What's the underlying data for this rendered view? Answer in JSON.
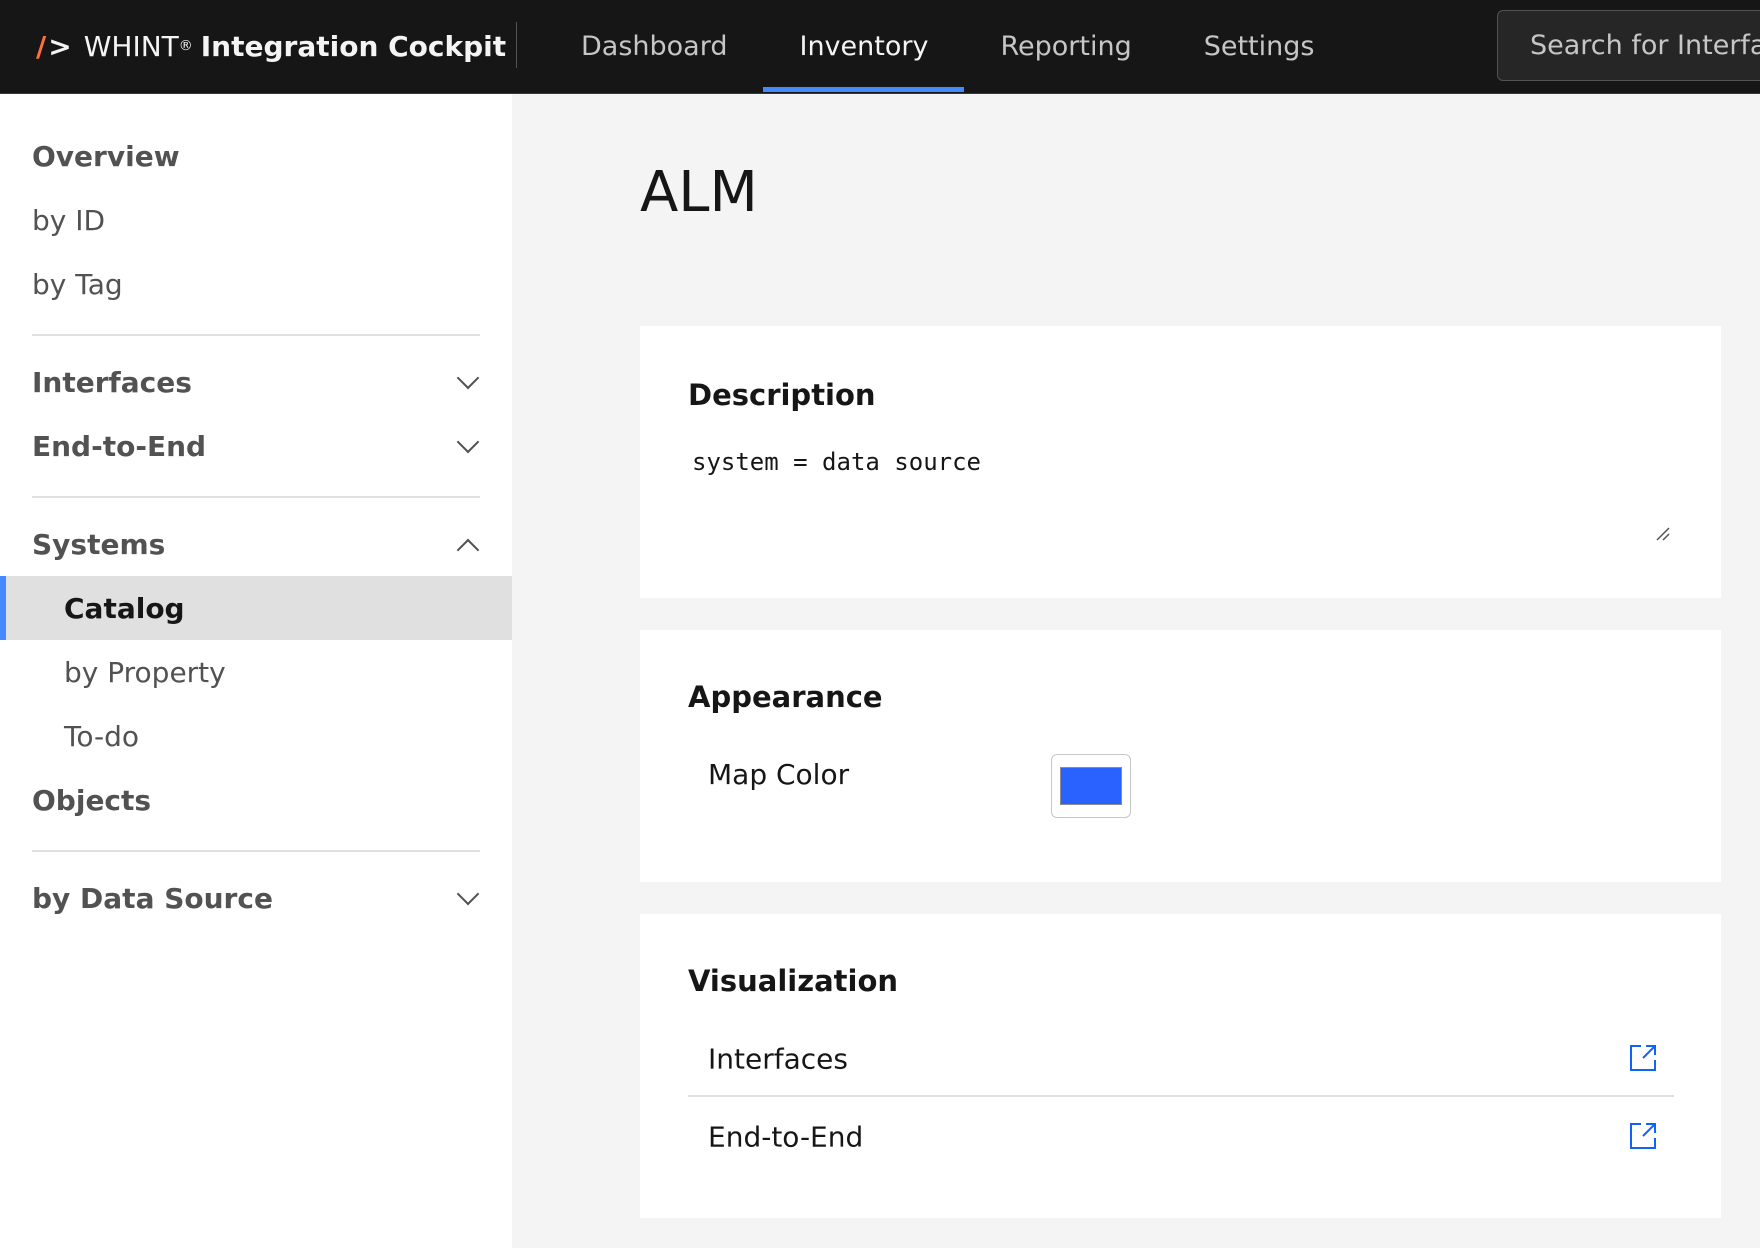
{
  "header": {
    "brand_slash": "/",
    "brand_gt": ">",
    "brand_name": "WHINT",
    "brand_reg": "®",
    "brand_product": "Integration Cockpit",
    "nav": [
      {
        "label": "Dashboard"
      },
      {
        "label": "Inventory"
      },
      {
        "label": "Reporting"
      },
      {
        "label": "Settings"
      }
    ],
    "active_nav": "Inventory",
    "search_placeholder": "Search for Interfaces"
  },
  "sidebar": {
    "overview": "Overview",
    "by_id": "by ID",
    "by_tag": "by Tag",
    "interfaces": "Interfaces",
    "end_to_end": "End-to-End",
    "systems": "Systems",
    "catalog": "Catalog",
    "by_property": "by Property",
    "todo": "To-do",
    "objects": "Objects",
    "by_data_source": "by Data Source"
  },
  "main": {
    "title": "ALM",
    "description": {
      "title": "Description",
      "text": "system = data source"
    },
    "appearance": {
      "title": "Appearance",
      "map_color_label": "Map Color",
      "map_color": "#2962ff"
    },
    "visualization": {
      "title": "Visualization",
      "rows": [
        {
          "label": "Interfaces"
        },
        {
          "label": "End-to-End"
        }
      ]
    }
  },
  "colors": {
    "accent": "#4589ff",
    "brand_slash": "#ff6f3c",
    "link_icon": "#0f62fe"
  },
  "icons": {
    "chevron": "chevron-down-icon",
    "external_link": "launch-icon"
  }
}
